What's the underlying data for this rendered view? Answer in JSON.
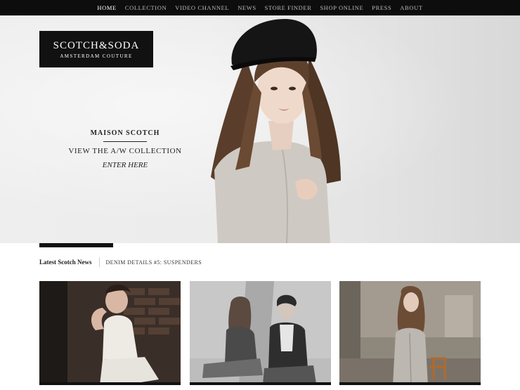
{
  "nav": {
    "items": [
      "HOME",
      "COLLECTION",
      "VIDEO CHANNEL",
      "NEWS",
      "STORE FINDER",
      "SHOP ONLINE",
      "PRESS",
      "ABOUT"
    ],
    "active": "HOME"
  },
  "logo": {
    "main": "SCOTCH&SODA",
    "sub": "AMSTERDAM COUTURE"
  },
  "promo": {
    "title": "MAISON SCOTCH",
    "link": "VIEW THE A/W COLLECTION",
    "enter": "ENTER HERE"
  },
  "news": {
    "label": "Latest Scotch News",
    "headline": "DENIM DETAILS #5: SUSPENDERS"
  },
  "colors": {
    "nav_bg": "#0d0d0d",
    "accent": "#111111",
    "hero_bg": "#e8e8e8"
  }
}
